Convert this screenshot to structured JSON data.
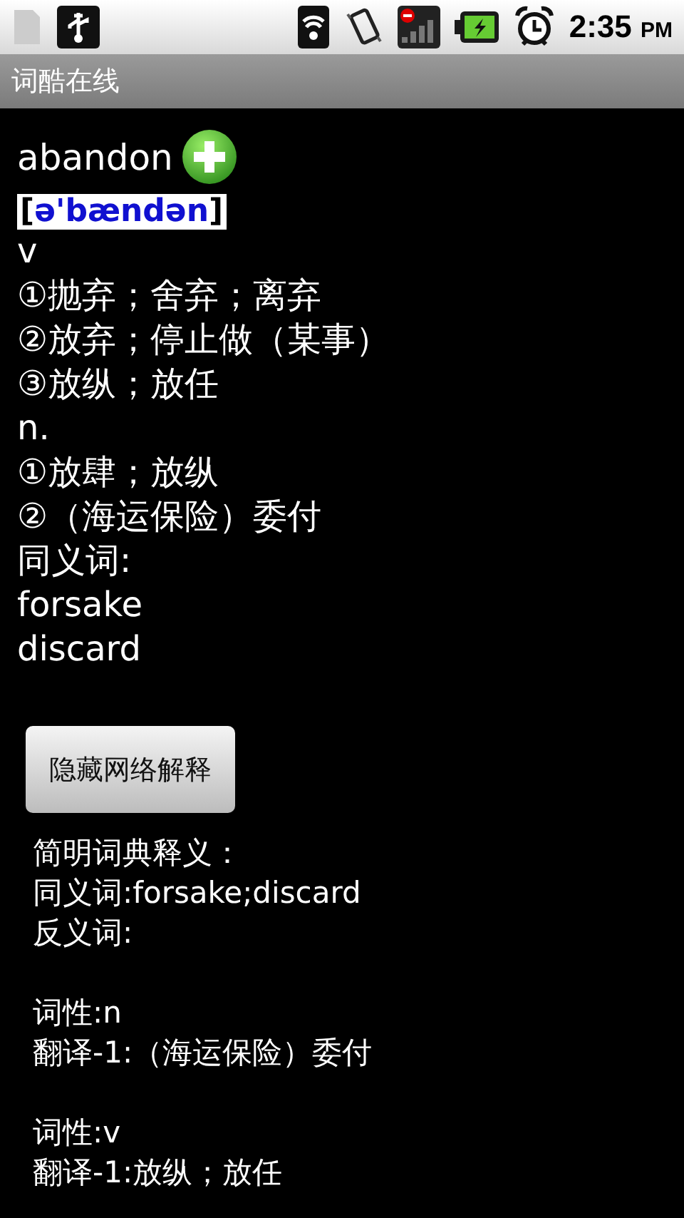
{
  "status_bar": {
    "time": "2:35",
    "ampm": "PM"
  },
  "title": "词酷在线",
  "entry": {
    "word": "abandon",
    "phonetic_open": "[",
    "phonetic": "ə'bændən",
    "phonetic_close": "]",
    "lines": [
      "v",
      "①抛弃；舍弃；离弃",
      "②放弃；停止做（某事）",
      "③放纵；放任",
      "n.",
      "①放肆；放纵",
      "②（海运保险）委付",
      "同义词:",
      "forsake",
      "discard"
    ]
  },
  "button": "隐藏网络解释",
  "details": [
    {
      "lines": [
        "简明词典释义：",
        "同义词:forsake;discard",
        "反义词:"
      ]
    },
    {
      "lines": [
        "词性:n",
        "翻译-1:（海运保险）委付"
      ]
    },
    {
      "lines": [
        "词性:v",
        "翻译-1:放纵；放任"
      ]
    }
  ]
}
